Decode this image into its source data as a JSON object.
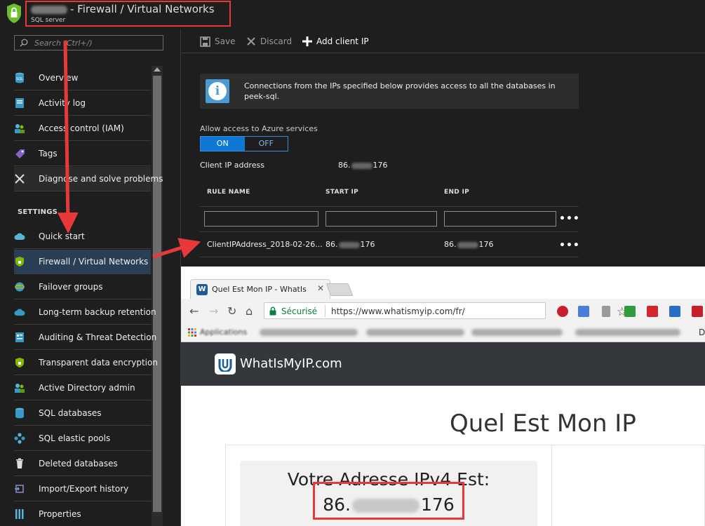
{
  "titlebar": {
    "title": "- Firewall / Virtual Networks",
    "subtitle": "SQL server"
  },
  "sidebar": {
    "search_placeholder": "Search (Ctrl+/)",
    "items": [
      {
        "label": "Overview",
        "icon": "sql-db-icon"
      },
      {
        "label": "Activity log",
        "icon": "activity-log-icon"
      },
      {
        "label": "Access control (IAM)",
        "icon": "people-icon"
      },
      {
        "label": "Tags",
        "icon": "tag-icon"
      },
      {
        "label": "Diagnose and solve problems",
        "icon": "wrench-icon"
      }
    ],
    "settings_heading": "SETTINGS",
    "settings_items": [
      {
        "label": "Quick start",
        "icon": "cloud-icon"
      },
      {
        "label": "Firewall / Virtual Networks",
        "icon": "shield-icon"
      },
      {
        "label": "Failover groups",
        "icon": "globe-icon"
      },
      {
        "label": "Long-term backup retention",
        "icon": "cloud-backup-icon"
      },
      {
        "label": "Auditing & Threat Detection",
        "icon": "audit-icon"
      },
      {
        "label": "Transparent data encryption",
        "icon": "shield-icon"
      },
      {
        "label": "Active Directory admin",
        "icon": "people-icon"
      },
      {
        "label": "SQL databases",
        "icon": "sql-db-icon"
      },
      {
        "label": "SQL elastic pools",
        "icon": "elastic-pool-icon"
      },
      {
        "label": "Deleted databases",
        "icon": "trash-icon"
      },
      {
        "label": "Import/Export history",
        "icon": "import-export-icon"
      },
      {
        "label": "Properties",
        "icon": "properties-icon"
      }
    ],
    "accent": "#0f78d4"
  },
  "toolbar": {
    "save_label": "Save",
    "discard_label": "Discard",
    "add_ip_label": "Add client IP"
  },
  "info": {
    "text": "Connections from the IPs specified below provides access to all the databases in peek-sql."
  },
  "azure_access": {
    "label": "Allow access to Azure services",
    "on_label": "ON",
    "off_label": "OFF",
    "selected": "ON"
  },
  "client_ip": {
    "label": "Client IP address",
    "prefix": "86.",
    "suffix": "176"
  },
  "rules": {
    "columns": [
      "RULE NAME",
      "START IP",
      "END IP"
    ],
    "rows": [
      {
        "name": "ClientIPAddress_2018-02-26...",
        "start_prefix": "86.",
        "start_suffix": "176",
        "end_prefix": "86.",
        "end_suffix": "176"
      }
    ]
  },
  "browser": {
    "tab_title": "Quel Est Mon IP - WhatIs",
    "secure_label": "Sécurisé",
    "url": "https://www.whatismyip.com/fr/",
    "bookmarks_apps": "Applications",
    "bookmarks_more": "Di",
    "site_name": "WhatIsMyIP.com",
    "heading": "Quel Est Mon IP",
    "ipv4_label": "Votre Adresse IPv4 Est:",
    "ipv4_prefix": "86.",
    "ipv4_suffix": "176"
  },
  "colors": {
    "highlight": "#e8393a",
    "azure_blue": "#0f78d4"
  }
}
